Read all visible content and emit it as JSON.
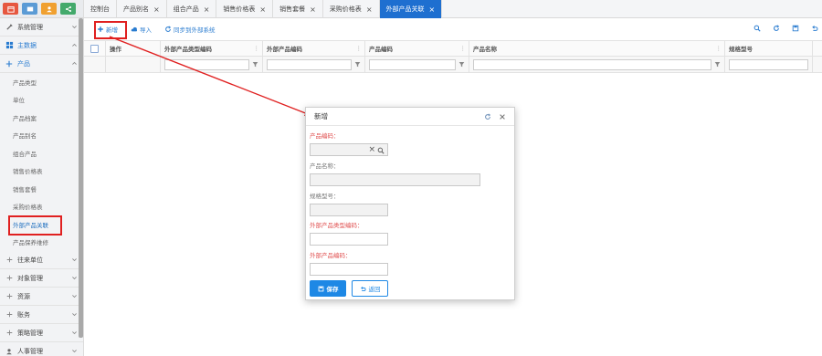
{
  "sidebar": {
    "top_button_colors": [
      "#e6573f",
      "#5b9bd5",
      "#f0a030",
      "#43a96b"
    ],
    "menus_top": [
      {
        "label": "系统管理",
        "icon": "tools-icon",
        "active": false
      },
      {
        "label": "主数据",
        "icon": "grid-icon",
        "active": true
      },
      {
        "label": "产品",
        "icon": "plus-icon",
        "active": true
      }
    ],
    "product_items": [
      "产品类型",
      "单位",
      "产品档案",
      "产品别名",
      "组合产品",
      "销售价格表",
      "销售套餐",
      "采购价格表",
      "外部产品关联",
      "产品保养维修"
    ],
    "menus_bottom": [
      "往来单位",
      "对象管理",
      "资源",
      "账务",
      "策略管理",
      "人事管理"
    ]
  },
  "tabs": [
    {
      "label": "控制台",
      "closable": false,
      "active": false
    },
    {
      "label": "产品别名",
      "closable": true,
      "active": false
    },
    {
      "label": "组合产品",
      "closable": true,
      "active": false
    },
    {
      "label": "销售价格表",
      "closable": true,
      "active": false
    },
    {
      "label": "销售套餐",
      "closable": true,
      "active": false
    },
    {
      "label": "采购价格表",
      "closable": true,
      "active": false
    },
    {
      "label": "外部产品关联",
      "closable": true,
      "active": true
    }
  ],
  "tab_close_glyph": "×",
  "toolbar": {
    "add_label": "新增",
    "import_label": "导入",
    "sync_label": "同步到外部系统",
    "right_icons": [
      "search-icon",
      "refresh-icon",
      "save-icon",
      "undo-icon"
    ]
  },
  "grid": {
    "columns": [
      "操作",
      "外部产品类型编码",
      "外部产品编码",
      "产品编码",
      "产品名称",
      "规格型号"
    ]
  },
  "modal": {
    "title": "新增",
    "fields": [
      {
        "label": "产品编码：",
        "required": true,
        "disabled": true,
        "lookup": true
      },
      {
        "label": "产品名称：",
        "required": false,
        "disabled": true,
        "lookup": false
      },
      {
        "label": "规格型号：",
        "required": false,
        "disabled": true,
        "lookup": false
      },
      {
        "label": "外部产品类型编码：",
        "required": true,
        "disabled": false,
        "lookup": false
      },
      {
        "label": "外部产品编码：",
        "required": true,
        "disabled": false,
        "lookup": false
      }
    ],
    "save_label": "保存",
    "back_label": "返回"
  },
  "colors": {
    "accent": "#1e6fd0",
    "highlight": "#e02020",
    "required": "#e05050"
  }
}
